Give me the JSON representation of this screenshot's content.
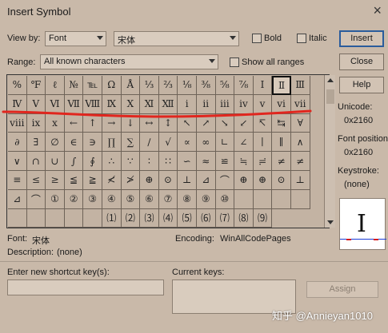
{
  "window": {
    "title": "Insert Symbol",
    "close_glyph": "×"
  },
  "view_by": {
    "label": "View by:",
    "value": "Font"
  },
  "font": {
    "value": "宋体"
  },
  "bold": {
    "label": "Bold",
    "checked": false
  },
  "italic": {
    "label": "Italic",
    "checked": false
  },
  "range": {
    "label": "Range:",
    "value": "All known characters"
  },
  "show_all_ranges": {
    "label": "Show all ranges",
    "checked": false
  },
  "buttons": {
    "insert": "Insert",
    "close": "Close",
    "help": "Help",
    "assign": "Assign"
  },
  "symbols": [
    [
      "%",
      "℉",
      "ℓ",
      "№",
      "℡",
      "Ω",
      "Å",
      "⅓",
      "⅔",
      "⅛",
      "⅜",
      "⅝",
      "⅞",
      "Ⅰ",
      "Ⅱ"
    ],
    [
      "Ⅲ",
      "Ⅳ",
      "Ⅴ",
      "Ⅵ",
      "Ⅶ",
      "Ⅷ",
      "Ⅸ",
      "Ⅹ",
      "Ⅺ",
      "Ⅻ",
      "ⅰ",
      "ⅱ",
      "ⅲ",
      "ⅳ",
      "ⅴ",
      "ⅵ"
    ],
    [
      "ⅶ",
      "ⅷ",
      "ⅸ",
      "ⅹ",
      "←",
      "↑",
      "→",
      "↓",
      "↔",
      "↕",
      "↖",
      "↗",
      "↘",
      "↙",
      "↸",
      "↹"
    ],
    [
      "∀",
      "∂",
      "∃",
      "∅",
      "∈",
      "∋",
      "∏",
      "∑",
      "∕",
      "√",
      "∝",
      "∞",
      "∟",
      "∠",
      "∣",
      "∥"
    ],
    [
      "∧",
      "∨",
      "∩",
      "∪",
      "∫",
      "∮",
      "∴",
      "∵",
      "∶",
      "∷",
      "∽",
      "≈",
      "≌",
      "≒",
      "≓",
      "≠"
    ],
    [
      "≠",
      "≡",
      "≤",
      "≥",
      "≦",
      "≧",
      "≮",
      "≯",
      "⊕",
      "⊙",
      "⊥",
      "⊿",
      "⌒",
      "⊕",
      "⊕",
      "⊙"
    ],
    [
      "⊥",
      "⊿",
      "⌒",
      "①",
      "②",
      "③",
      "④",
      "⑤",
      "⑥",
      "⑦",
      "⑧",
      "⑨",
      "⑩",
      "",
      "",
      ""
    ],
    [
      "",
      "",
      "",
      "",
      "",
      "",
      "⑴",
      "⑵",
      "⑶",
      "⑷",
      "⑸",
      "⑹",
      "⑺",
      "⑻",
      "⑼"
    ]
  ],
  "selected_symbol": {
    "row": 0,
    "col": 14
  },
  "unicode": {
    "label": "Unicode:",
    "value": "0x2160"
  },
  "font_position": {
    "label": "Font position:",
    "value": "0x2160"
  },
  "keystroke": {
    "label": "Keystroke:",
    "value": "(none)"
  },
  "preview_char": "Ⅰ",
  "font_info": {
    "label": "Font:",
    "value": "宋体"
  },
  "encoding": {
    "label": "Encoding:",
    "value": "WinAllCodePages"
  },
  "description": {
    "label": "Description:",
    "value": "(none)"
  },
  "shortcut": {
    "label": "Enter new shortcut key(s):",
    "value": ""
  },
  "current_keys": {
    "label": "Current keys:"
  },
  "watermark": "知乎 @Annieyan1010",
  "colors": {
    "background": "#c9b9a9",
    "annotation": "#e0261e",
    "accent": "#2a5c9c"
  }
}
